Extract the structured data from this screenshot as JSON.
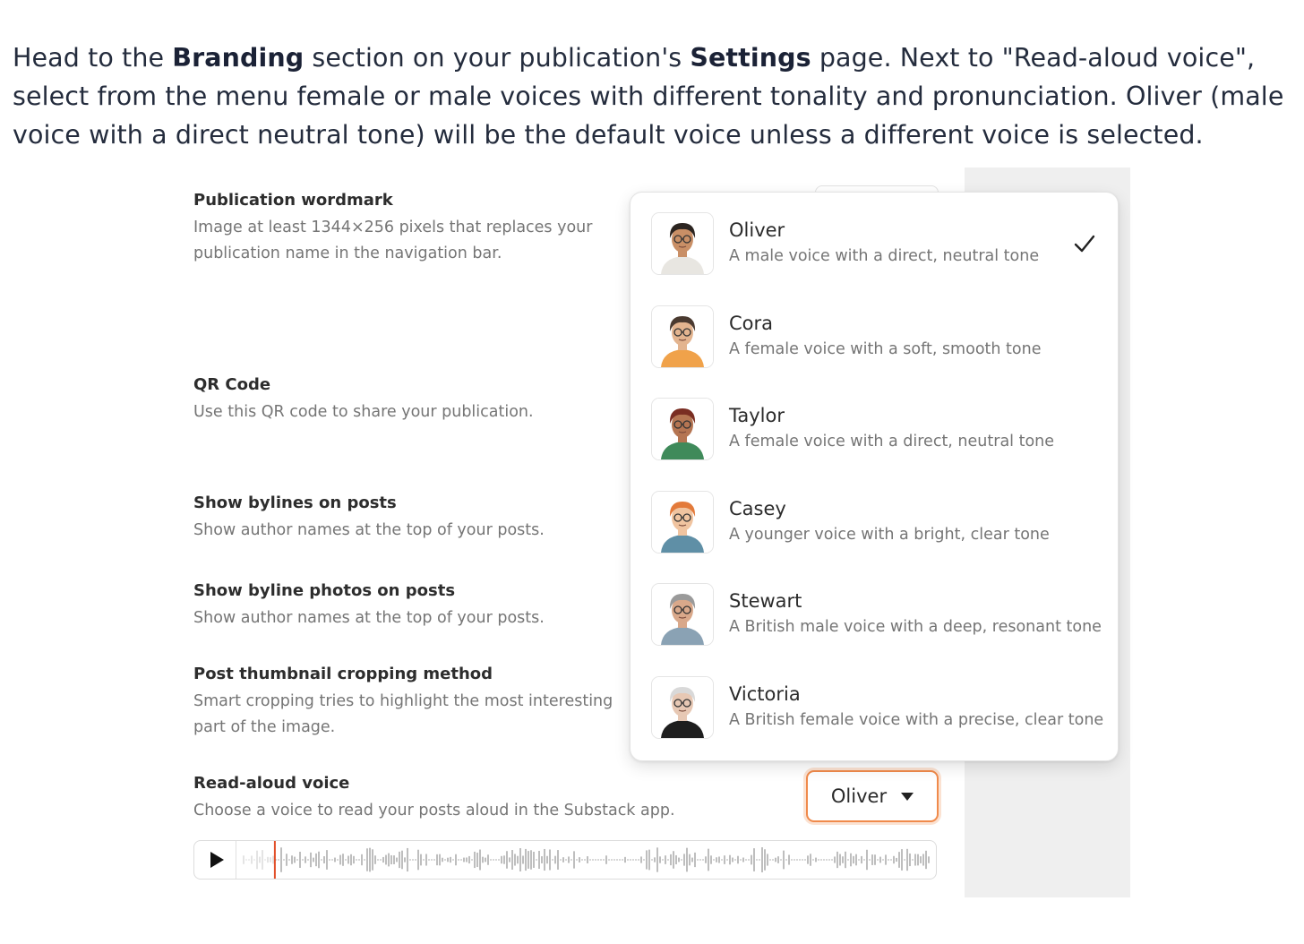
{
  "intro": {
    "t1": "Head to the ",
    "b1": "Branding",
    "t2": " section on your publication's ",
    "b2": "Settings",
    "t3": " page. Next to \"Read-aloud voice\", select from the menu female or male voices with different tonality and pronunciation. Oliver (male voice with a direct neutral tone) will be the default voice unless a different voice is selected."
  },
  "settings": {
    "wordmark": {
      "title": "Publication wordmark",
      "desc": "Image at least 1344×256 pixels that replaces your publication name in the navigation bar."
    },
    "qr": {
      "title": "QR Code",
      "desc": "Use this QR code to share your publication."
    },
    "bylines": {
      "title": "Show bylines on posts",
      "desc": "Show author names at the top of your posts."
    },
    "byline_photos": {
      "title": "Show byline photos on posts",
      "desc": "Show author names at the top of your posts."
    },
    "thumbnail": {
      "title": "Post thumbnail cropping method",
      "desc": "Smart cropping tries to highlight the most interesting part of the image."
    },
    "voice": {
      "title": "Read-aloud voice",
      "desc": "Choose a voice to read your posts aloud in the Substack app.",
      "selected": "Oliver"
    }
  },
  "player": {
    "playhead_fraction": 0.055
  },
  "voices": [
    {
      "name": "Oliver",
      "desc": "A male voice with a direct, neutral tone",
      "selected": true,
      "skin": "#c98f66",
      "hair": "#2b2420",
      "shirt": "#e8e6e1"
    },
    {
      "name": "Cora",
      "desc": "A female voice with a soft, smooth tone",
      "selected": false,
      "skin": "#e3b48f",
      "hair": "#4a3a30",
      "shirt": "#f0a24a"
    },
    {
      "name": "Taylor",
      "desc": "A female voice with a direct, neutral tone",
      "selected": false,
      "skin": "#b57552",
      "hair": "#7a2d22",
      "shirt": "#3f8a5a"
    },
    {
      "name": "Casey",
      "desc": "A younger voice with a bright, clear tone",
      "selected": false,
      "skin": "#f0c4a0",
      "hair": "#e37a3a",
      "shirt": "#5f8fa6"
    },
    {
      "name": "Stewart",
      "desc": "A British male voice with a deep, resonant tone",
      "selected": false,
      "skin": "#d9a88a",
      "hair": "#9a9a9a",
      "shirt": "#8aa2b4"
    },
    {
      "name": "Victoria",
      "desc": "A British female voice with a precise, clear tone",
      "selected": false,
      "skin": "#e7c8b4",
      "hair": "#d9d9d9",
      "shirt": "#1e1e1e"
    }
  ],
  "colors": {
    "accent": "#f08a4b",
    "playhead": "#e2502a",
    "check": "#222222"
  },
  "icons": {
    "play": "play-icon",
    "caret": "caret-down-icon",
    "check": "checkmark-icon"
  }
}
